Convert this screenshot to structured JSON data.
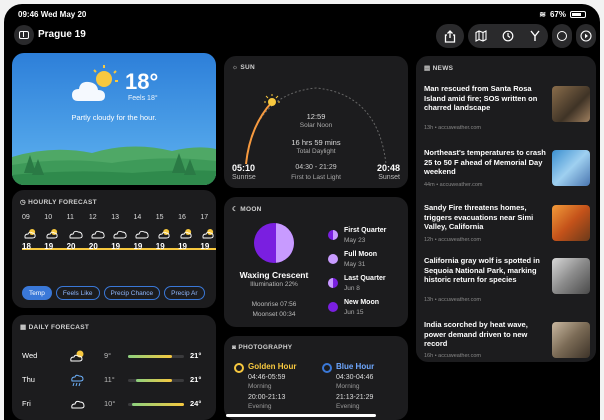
{
  "status_bar": {
    "time": "09:46",
    "date": "Wed May 20",
    "battery": "67%"
  },
  "header": {
    "location": "Prague 19"
  },
  "current": {
    "temperature": "18°",
    "feels_like": "Feels 18°",
    "summary": "Partly cloudy for the hour."
  },
  "hourly": {
    "title": "HOURLY FORECAST",
    "hours": [
      "09",
      "10",
      "11",
      "12",
      "13",
      "14",
      "15",
      "16",
      "17"
    ],
    "temps": [
      "18",
      "19",
      "20",
      "20",
      "19",
      "19",
      "19",
      "19",
      "19"
    ],
    "tabs": [
      "Temp",
      "Feels Like",
      "Precip Chance",
      "Precip Ar"
    ]
  },
  "daily": {
    "title": "DAILY FORECAST",
    "days": [
      {
        "day": "Wed",
        "low": "9°",
        "high": "21°",
        "icon": "partly-sunny-icon",
        "range": [
          0.0,
          0.78
        ]
      },
      {
        "day": "Thu",
        "low": "11°",
        "high": "21°",
        "icon": "rain-icon",
        "range": [
          0.15,
          0.78
        ]
      },
      {
        "day": "Fri",
        "low": "10°",
        "high": "24°",
        "icon": "cloud-icon",
        "range": [
          0.08,
          1.0
        ]
      }
    ]
  },
  "sun": {
    "title": "SUN",
    "solar_noon_time": "12:59",
    "solar_noon_label": "Solar Noon",
    "daylight": "16 hrs 59 mins",
    "daylight_label": "Total Daylight",
    "sunrise_time": "05:10",
    "sunrise_label": "Sunrise",
    "first_last_light": "04:30 - 21:29",
    "first_last_light_label": "First to Last Light",
    "sunset_time": "20:48",
    "sunset_label": "Sunset"
  },
  "moon": {
    "title": "MOON",
    "phase": "Waxing Crescent",
    "illumination": "Illumination 22%",
    "moonrise": "Moonrise 07:56",
    "moonset": "Moonset 00:34",
    "phases": [
      {
        "name": "First Quarter",
        "date": "May 23"
      },
      {
        "name": "Full Moon",
        "date": "May 31"
      },
      {
        "name": "Last Quarter",
        "date": "Jun 8"
      },
      {
        "name": "New Moon",
        "date": "Jun 15"
      }
    ]
  },
  "photography": {
    "title": "PHOTOGRAPHY",
    "golden": {
      "title": "Golden Hour",
      "morning": "04:46-05:59",
      "morning_label": "Morning",
      "evening": "20:00-21:13",
      "evening_label": "Evening"
    },
    "blue": {
      "title": "Blue Hour",
      "morning": "04:30-04:46",
      "morning_label": "Morning",
      "evening": "21:13-21:29",
      "evening_label": "Evening"
    }
  },
  "news": {
    "title": "NEWS",
    "items": [
      {
        "headline": "Man rescued from Santa Rosa Island amid fire; SOS written on charred landscape",
        "source": "13h • accuweather.com"
      },
      {
        "headline": "Northeast's temperatures to crash 25 to 50 F ahead of Memorial Day weekend",
        "source": "44m • accuweather.com"
      },
      {
        "headline": "Sandy Fire threatens homes, triggers evacuations near Simi Valley, California",
        "source": "12h • accuweather.com"
      },
      {
        "headline": "California gray wolf is spotted in Sequoia National Park, marking historic return for species",
        "source": "13h • accuweather.com"
      },
      {
        "headline": "India scorched by heat wave, power demand driven to new record",
        "source": "16h • accuweather.com"
      }
    ]
  },
  "colors": {
    "accent": "#3a78d8",
    "sun_yellow": "#f7c83f",
    "moon_purple": "#7a1fe0",
    "golden": "#f7c83f",
    "blue_hour": "#3a78d8"
  }
}
